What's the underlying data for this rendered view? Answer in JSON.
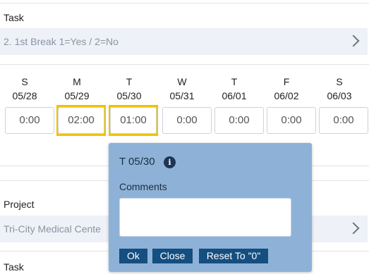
{
  "task_card": {
    "label": "Task",
    "selected_task": "2. 1st Break 1=Yes / 2=No"
  },
  "week": [
    {
      "dow": "S",
      "date": "05/28",
      "hours": "0:00"
    },
    {
      "dow": "M",
      "date": "05/29",
      "hours": "02:00"
    },
    {
      "dow": "T",
      "date": "05/30",
      "hours": "01:00"
    },
    {
      "dow": "W",
      "date": "05/31",
      "hours": "0:00"
    },
    {
      "dow": "T",
      "date": "06/01",
      "hours": "0:00"
    },
    {
      "dow": "F",
      "date": "06/02",
      "hours": "0:00"
    },
    {
      "dow": "S",
      "date": "06/03",
      "hours": "0:00"
    }
  ],
  "project_card": {
    "label": "Project",
    "selected_project": "Tri-City Medical Cente",
    "task_label": "Task"
  },
  "popover": {
    "title": "T 05/30",
    "info_icon": "i",
    "comments_label": "Comments",
    "comments_value": "",
    "ok_label": "Ok",
    "close_label": "Close",
    "reset_label": "Reset To \"0\""
  },
  "colors": {
    "highlight": "#f2c200",
    "popover_bg": "#8eb2d7",
    "button_bg": "#154e80",
    "select_bg": "#eef1f7"
  }
}
